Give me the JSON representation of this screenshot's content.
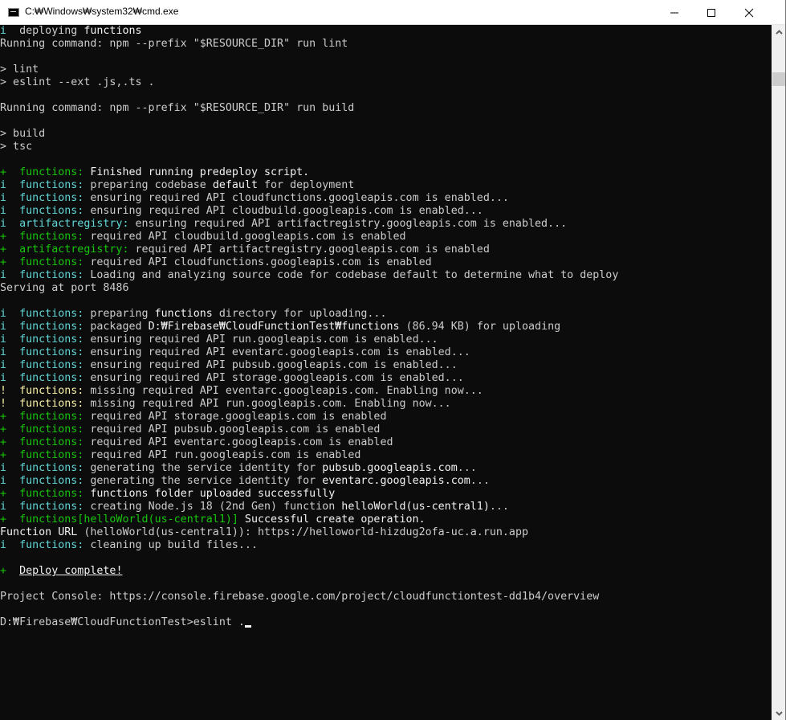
{
  "window": {
    "title": "C:₩Windows₩system32₩cmd.exe",
    "icon": "console-icon",
    "controls": [
      "minimize-icon",
      "maximize-icon",
      "close-icon"
    ]
  },
  "colors": {
    "gray": "#cccccc",
    "white": "#f2f2f2",
    "cyan": "#61d6d6",
    "green": "#16c60c",
    "yellow": "#f9f1a5",
    "background": "#0c0c0c"
  },
  "terminal": {
    "lines": [
      [
        {
          "t": "i  ",
          "c": "cyan"
        },
        {
          "t": "deploying ",
          "c": "gray"
        },
        {
          "t": "functions",
          "c": "white"
        }
      ],
      [
        {
          "t": "Running command: npm --prefix \"$RESOURCE_DIR\" run lint",
          "c": "gray"
        }
      ],
      [],
      [
        {
          "t": "> lint",
          "c": "gray"
        }
      ],
      [
        {
          "t": "> eslint --ext .js,.ts .",
          "c": "gray"
        }
      ],
      [],
      [
        {
          "t": "Running command: npm --prefix \"$RESOURCE_DIR\" run build",
          "c": "gray"
        }
      ],
      [],
      [
        {
          "t": "> build",
          "c": "gray"
        }
      ],
      [
        {
          "t": "> tsc",
          "c": "gray"
        }
      ],
      [],
      [
        {
          "t": "+  functions:",
          "c": "green"
        },
        {
          "t": " Finished running predeploy script.",
          "c": "white"
        }
      ],
      [
        {
          "t": "i  functions:",
          "c": "cyan"
        },
        {
          "t": " preparing codebase ",
          "c": "gray"
        },
        {
          "t": "default",
          "c": "white"
        },
        {
          "t": " for deployment",
          "c": "gray"
        }
      ],
      [
        {
          "t": "i  functions:",
          "c": "cyan"
        },
        {
          "t": " ensuring required API cloudfunctions.googleapis.com is enabled...",
          "c": "gray"
        }
      ],
      [
        {
          "t": "i  functions:",
          "c": "cyan"
        },
        {
          "t": " ensuring required API cloudbuild.googleapis.com is enabled...",
          "c": "gray"
        }
      ],
      [
        {
          "t": "i  artifactregistry:",
          "c": "cyan"
        },
        {
          "t": " ensuring required API artifactregistry.googleapis.com is enabled...",
          "c": "gray"
        }
      ],
      [
        {
          "t": "+  functions:",
          "c": "green"
        },
        {
          "t": " required API cloudbuild.googleapis.com is enabled",
          "c": "gray"
        }
      ],
      [
        {
          "t": "+  artifactregistry:",
          "c": "green"
        },
        {
          "t": " required API artifactregistry.googleapis.com is enabled",
          "c": "gray"
        }
      ],
      [
        {
          "t": "+  functions:",
          "c": "green"
        },
        {
          "t": " required API cloudfunctions.googleapis.com is enabled",
          "c": "gray"
        }
      ],
      [
        {
          "t": "i  functions:",
          "c": "cyan"
        },
        {
          "t": " Loading and analyzing source code for codebase default to determine what to deploy",
          "c": "gray"
        }
      ],
      [
        {
          "t": "Serving at port 8486",
          "c": "gray"
        }
      ],
      [],
      [
        {
          "t": "i  functions:",
          "c": "cyan"
        },
        {
          "t": " preparing ",
          "c": "gray"
        },
        {
          "t": "functions",
          "c": "white"
        },
        {
          "t": " directory for uploading...",
          "c": "gray"
        }
      ],
      [
        {
          "t": "i  functions:",
          "c": "cyan"
        },
        {
          "t": " packaged ",
          "c": "gray"
        },
        {
          "t": "D:₩Firebase₩CloudFunctionTest₩functions",
          "c": "white"
        },
        {
          "t": " (86.94 KB) for uploading",
          "c": "gray"
        }
      ],
      [
        {
          "t": "i  functions:",
          "c": "cyan"
        },
        {
          "t": " ensuring required API run.googleapis.com is enabled...",
          "c": "gray"
        }
      ],
      [
        {
          "t": "i  functions:",
          "c": "cyan"
        },
        {
          "t": " ensuring required API eventarc.googleapis.com is enabled...",
          "c": "gray"
        }
      ],
      [
        {
          "t": "i  functions:",
          "c": "cyan"
        },
        {
          "t": " ensuring required API pubsub.googleapis.com is enabled...",
          "c": "gray"
        }
      ],
      [
        {
          "t": "i  functions:",
          "c": "cyan"
        },
        {
          "t": " ensuring required API storage.googleapis.com is enabled...",
          "c": "gray"
        }
      ],
      [
        {
          "t": "!  functions:",
          "c": "yellow"
        },
        {
          "t": " missing required API eventarc.googleapis.com. Enabling now...",
          "c": "gray"
        }
      ],
      [
        {
          "t": "!  functions:",
          "c": "yellow"
        },
        {
          "t": " missing required API run.googleapis.com. Enabling now...",
          "c": "gray"
        }
      ],
      [
        {
          "t": "+  functions:",
          "c": "green"
        },
        {
          "t": " required API storage.googleapis.com is enabled",
          "c": "gray"
        }
      ],
      [
        {
          "t": "+  functions:",
          "c": "green"
        },
        {
          "t": " required API pubsub.googleapis.com is enabled",
          "c": "gray"
        }
      ],
      [
        {
          "t": "+  functions:",
          "c": "green"
        },
        {
          "t": " required API eventarc.googleapis.com is enabled",
          "c": "gray"
        }
      ],
      [
        {
          "t": "+  functions:",
          "c": "green"
        },
        {
          "t": " required API run.googleapis.com is enabled",
          "c": "gray"
        }
      ],
      [
        {
          "t": "i  functions:",
          "c": "cyan"
        },
        {
          "t": " generating the service identity for ",
          "c": "gray"
        },
        {
          "t": "pubsub.googleapis.com",
          "c": "white"
        },
        {
          "t": "...",
          "c": "gray"
        }
      ],
      [
        {
          "t": "i  functions:",
          "c": "cyan"
        },
        {
          "t": " generating the service identity for ",
          "c": "gray"
        },
        {
          "t": "eventarc.googleapis.com",
          "c": "white"
        },
        {
          "t": "...",
          "c": "gray"
        }
      ],
      [
        {
          "t": "+  functions:",
          "c": "green"
        },
        {
          "t": " functions folder uploaded successfully",
          "c": "white"
        }
      ],
      [
        {
          "t": "i  functions:",
          "c": "cyan"
        },
        {
          "t": " creating Node.js 18 (2nd Gen) function ",
          "c": "gray"
        },
        {
          "t": "helloWorld(us-central1)",
          "c": "white"
        },
        {
          "t": "...",
          "c": "gray"
        }
      ],
      [
        {
          "t": "+  functions[helloWorld(us-central1)]",
          "c": "green"
        },
        {
          "t": " Successful create operation.",
          "c": "white"
        }
      ],
      [
        {
          "t": "Function URL",
          "c": "white"
        },
        {
          "t": " (helloWorld(us-central1)): https://helloworld-hizdug2ofa-uc.a.run.app",
          "c": "gray"
        }
      ],
      [
        {
          "t": "i  functions:",
          "c": "cyan"
        },
        {
          "t": " cleaning up build files...",
          "c": "gray"
        }
      ],
      [],
      [
        {
          "t": "+  ",
          "c": "green"
        },
        {
          "t": "Deploy complete!",
          "c": "white",
          "u": true
        }
      ],
      [],
      [
        {
          "t": "Project Console: https://console.firebase.google.com/project/cloudfunctiontest-dd1b4/overview",
          "c": "gray"
        }
      ],
      [],
      [
        {
          "t": "D:₩Firebase₩CloudFunctionTest>eslint .",
          "c": "gray"
        }
      ]
    ],
    "prompt_line_index": 46
  }
}
